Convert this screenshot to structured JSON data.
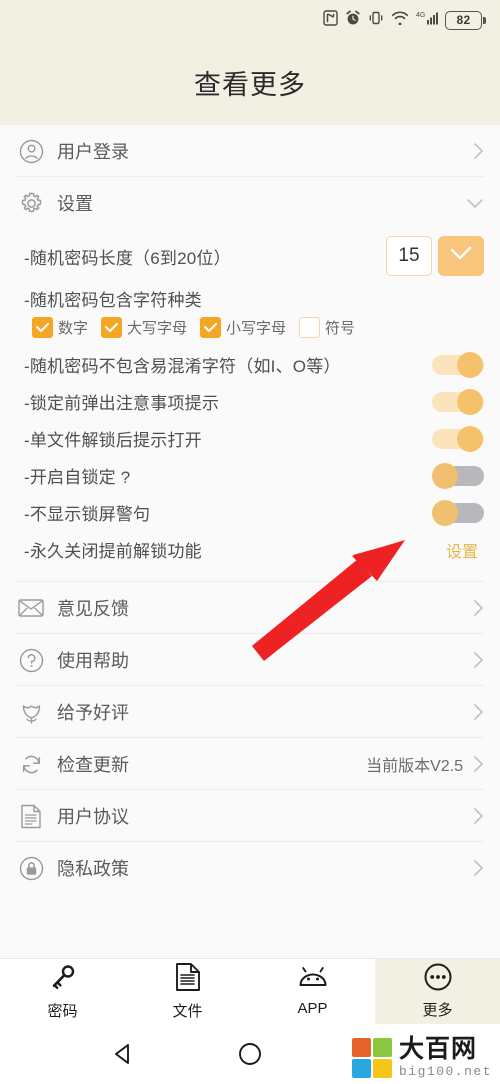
{
  "statusbar": {
    "icons": [
      "nfc-icon",
      "alarm-icon",
      "vibrate-icon",
      "wifi-icon",
      "signal-4g-icon"
    ],
    "network_label": "4G",
    "battery_level": "82"
  },
  "header": {
    "title": "查看更多"
  },
  "account_row": {
    "label": "用户登录",
    "icon": "user-icon",
    "chevron": "›"
  },
  "settings": {
    "label": "设置",
    "icon": "gear-icon",
    "collapse_chevron": "⌄",
    "password_length": {
      "label": "-随机密码长度（6到20位）",
      "value": "15",
      "confirm_icon": "check-icon"
    },
    "charset": {
      "label": "-随机密码包含字符种类",
      "options": [
        {
          "label": "数字",
          "checked": true
        },
        {
          "label": "大写字母",
          "checked": true
        },
        {
          "label": "小写字母",
          "checked": true
        },
        {
          "label": "符号",
          "checked": false
        }
      ]
    },
    "toggles": [
      {
        "label": "-随机密码不包含易混淆字符（如I、O等）",
        "on": true
      },
      {
        "label": "-锁定前弹出注意事项提示",
        "on": true
      },
      {
        "label": "-单文件解锁后提示打开",
        "on": true
      },
      {
        "label": "-开启自锁定 ?",
        "on": false,
        "help_icon": "question-circle-icon"
      },
      {
        "label": "-不显示锁屏警句",
        "on": false
      }
    ],
    "permanent_disable": {
      "label": "-永久关闭提前解锁功能",
      "action_label": "设置"
    }
  },
  "menu_rows": [
    {
      "label": "意见反馈",
      "icon": "mail-icon",
      "value": "",
      "chevron": "›"
    },
    {
      "label": "使用帮助",
      "icon": "question-circle-icon",
      "value": "",
      "chevron": "›"
    },
    {
      "label": "给予好评",
      "icon": "tulip-icon",
      "value": "",
      "chevron": "›"
    },
    {
      "label": "检查更新",
      "icon": "refresh-icon",
      "value": "当前版本V2.5",
      "chevron": "›"
    },
    {
      "label": "用户协议",
      "icon": "document-icon",
      "value": "",
      "chevron": "›"
    },
    {
      "label": "隐私政策",
      "icon": "lock-circle-icon",
      "value": "",
      "chevron": "›"
    }
  ],
  "bottom_nav": [
    {
      "label": "密码",
      "icon": "key-icon",
      "active": false
    },
    {
      "label": "文件",
      "icon": "file-icon",
      "active": false
    },
    {
      "label": "APP",
      "icon": "android-icon",
      "active": false
    },
    {
      "label": "更多",
      "icon": "more-dots-icon",
      "active": true
    }
  ],
  "system_nav": [
    {
      "icon": "back-triangle-icon"
    },
    {
      "icon": "home-circle-icon"
    },
    {
      "icon": "recents-square-icon"
    }
  ],
  "annotation": {
    "type": "red-arrow",
    "points_to": "不显示锁屏警句"
  },
  "watermark": {
    "title": "大百网",
    "subtitle": "big100.net",
    "colors": [
      "#E8622C",
      "#8CC63F",
      "#29A8E0",
      "#F5C518"
    ]
  },
  "colors": {
    "accent": "#f5a623",
    "toggle_on": "#f5c26b",
    "toggle_off_track": "#b6b8bb",
    "header_bg": "#f2efe3",
    "body_bg": "#fafafa",
    "annotation_red": "#ee2222"
  }
}
